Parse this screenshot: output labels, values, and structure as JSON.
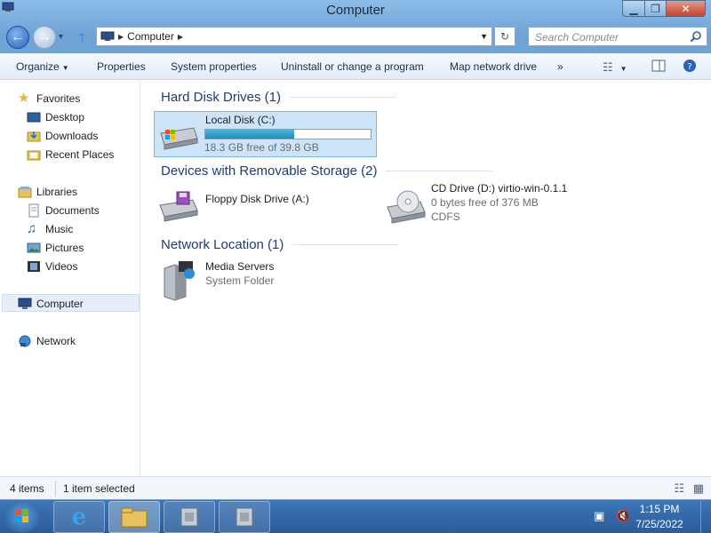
{
  "window": {
    "title": "Computer"
  },
  "address": {
    "crumb": "Computer",
    "search_placeholder": "Search Computer"
  },
  "commands": {
    "organize": "Organize",
    "properties": "Properties",
    "system_properties": "System properties",
    "uninstall": "Uninstall or change a program",
    "map_drive": "Map network drive",
    "more": "»"
  },
  "nav": {
    "favorites": "Favorites",
    "desktop": "Desktop",
    "downloads": "Downloads",
    "recent": "Recent Places",
    "libraries": "Libraries",
    "documents": "Documents",
    "music": "Music",
    "pictures": "Pictures",
    "videos": "Videos",
    "computer": "Computer",
    "network": "Network"
  },
  "groups": {
    "hdd": "Hard Disk Drives (1)",
    "removable": "Devices with Removable Storage (2)",
    "network": "Network Location (1)"
  },
  "items": {
    "local_disk": {
      "name": "Local Disk (C:)",
      "free": "18.3 GB free of 39.8 GB",
      "used_fraction": 0.54
    },
    "floppy": {
      "name": "Floppy Disk Drive (A:)"
    },
    "cd": {
      "name": "CD Drive (D:) virtio-win-0.1.1",
      "free": "0 bytes free of 376 MB",
      "fs": "CDFS"
    },
    "media": {
      "name": "Media Servers",
      "type": "System Folder"
    }
  },
  "status": {
    "count": "4 items",
    "selected": "1 item selected"
  },
  "taskbar": {
    "time": "1:15 PM",
    "date": "7/25/2022"
  },
  "colors": {
    "accent": "#1e3b75",
    "selection": "#cce4f7",
    "bar_fill": "#26a0da"
  }
}
